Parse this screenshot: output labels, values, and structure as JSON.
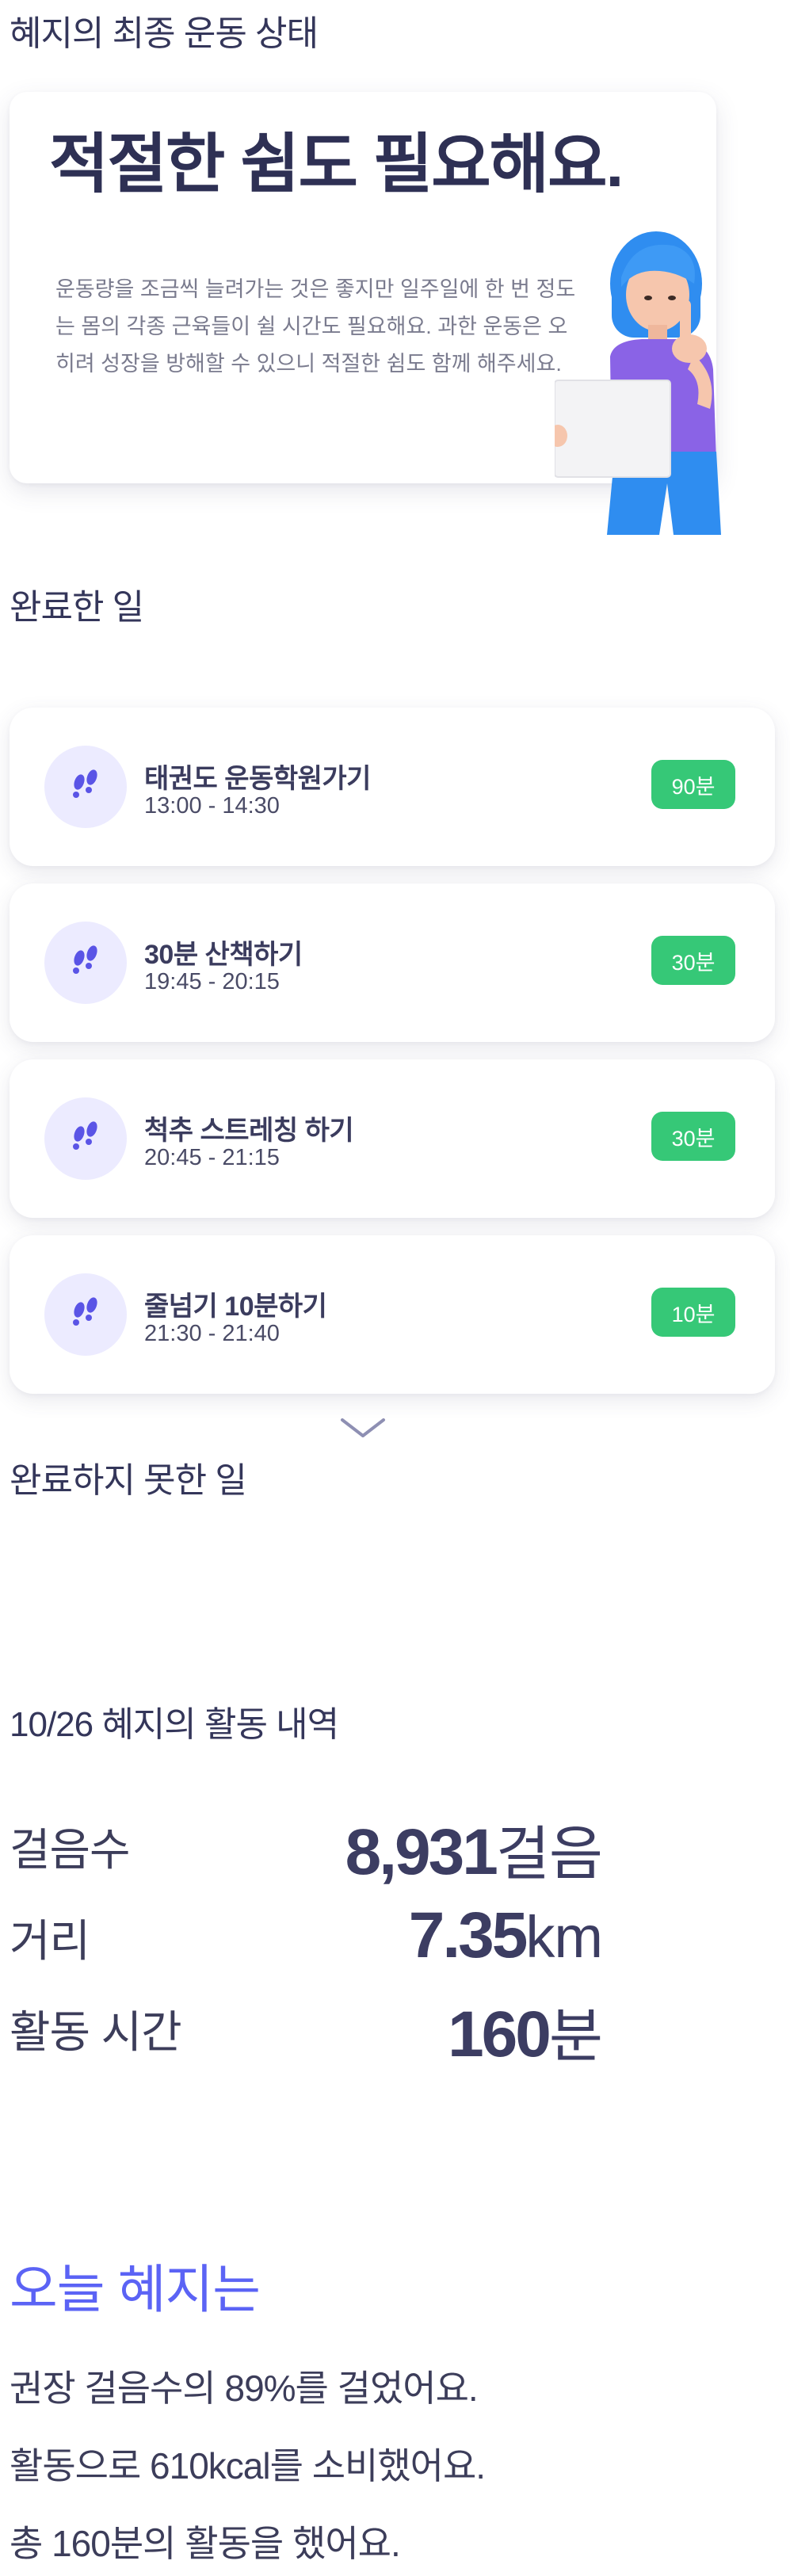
{
  "status": {
    "section_title": "혜지의 최종 운동 상태",
    "headline": "적절한 쉼도 필요해요.",
    "body": "운동량을 조금씩 늘려가는 것은 좋지만 일주일에 한 번 정도는 몸의 각종 근육들이 쉴 시간도 필요해요. 과한 운동은 오히려 성장을 방해할 수 있으니 적절한 쉼도 함께 해주세요."
  },
  "completed": {
    "title": "완료한 일",
    "items": [
      {
        "title": "태권도 운동학원가기",
        "time": "13:00 - 14:30",
        "badge": "90분",
        "icon": "footprints-icon"
      },
      {
        "title": "30분 산책하기",
        "time": "19:45 - 20:15",
        "badge": "30분",
        "icon": "footprints-icon"
      },
      {
        "title": "척추 스트레칭 하기",
        "time": "20:45 - 21:15",
        "badge": "30분",
        "icon": "footprints-icon"
      },
      {
        "title": "줄넘기 10분하기",
        "time": "21:30 - 21:40",
        "badge": "10분",
        "icon": "footprints-icon"
      }
    ],
    "expand_icon": "chevron-down-icon"
  },
  "incomplete": {
    "title": "완료하지 못한 일"
  },
  "activity": {
    "title": "10/26 혜지의 활동 내역",
    "steps": {
      "label": "걸음수",
      "value": "8,931",
      "unit": "걸음"
    },
    "distance": {
      "label": "거리",
      "value": "7.35",
      "unit": "km"
    },
    "duration": {
      "label": "활동 시간",
      "value": "160",
      "unit": "분"
    }
  },
  "summary": {
    "title": "오늘 혜지는",
    "lines": [
      "권장 걸음수의 89%를 걸었어요.",
      "활동으로 610kcal를 소비했어요.",
      "총 160분의 활동을 했어요."
    ]
  },
  "colors": {
    "accent": "#5b63f5",
    "badge": "#36c877",
    "icon_bg": "#ecebff",
    "icon": "#5a54e6",
    "text": "#3c3d5a"
  }
}
